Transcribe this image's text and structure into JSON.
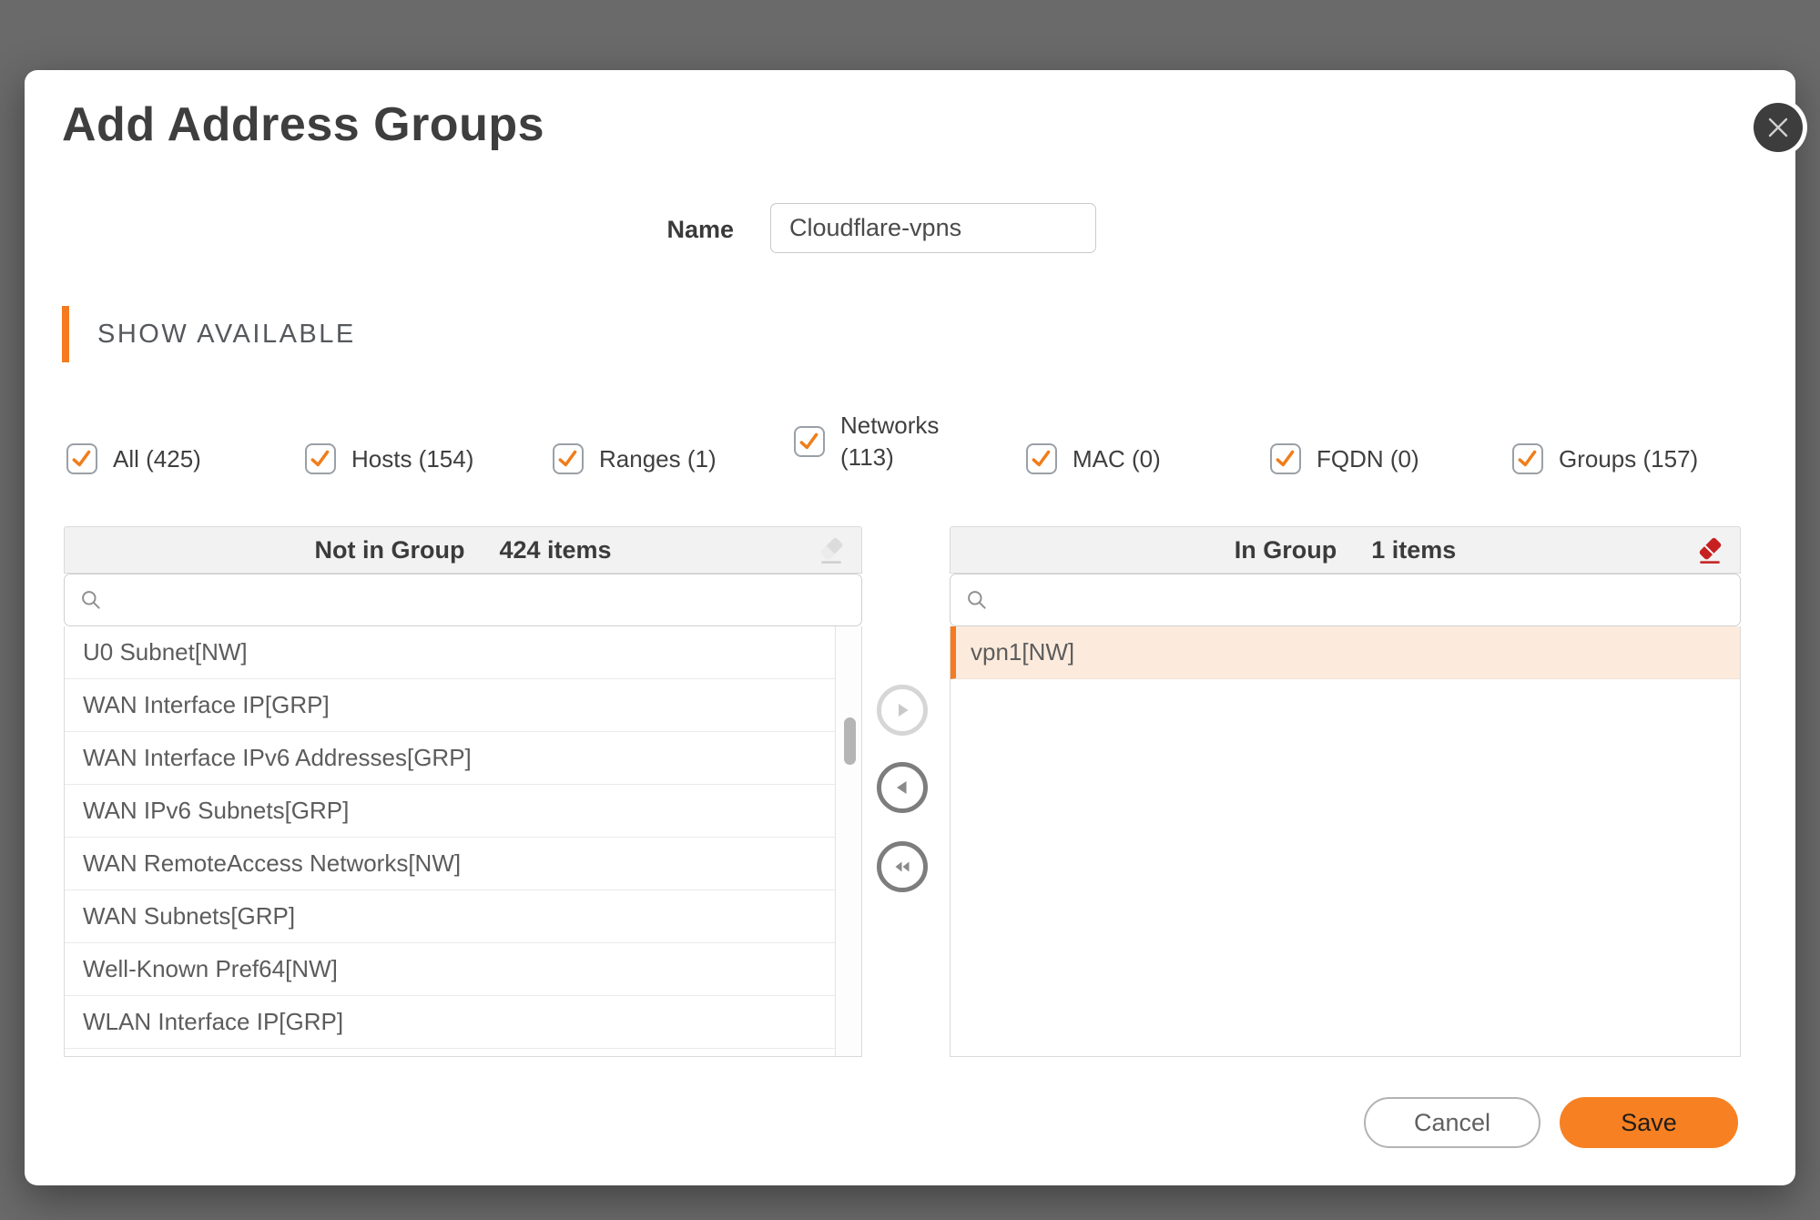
{
  "modal": {
    "title": "Add Address Groups"
  },
  "name_field": {
    "label": "Name",
    "value": "Cloudflare-vpns"
  },
  "section_header": {
    "label": "SHOW AVAILABLE"
  },
  "filters": {
    "items": [
      {
        "label": "All (425)",
        "checked": true
      },
      {
        "label": "Hosts (154)",
        "checked": true
      },
      {
        "label": "Ranges (1)",
        "checked": true
      },
      {
        "label": "Networks (113)",
        "checked": true
      },
      {
        "label": "MAC (0)",
        "checked": true
      },
      {
        "label": "FQDN (0)",
        "checked": true
      },
      {
        "label": "Groups (157)",
        "checked": true
      }
    ]
  },
  "left_panel": {
    "title": "Not in Group",
    "count": "424 items",
    "search_value": "",
    "items": [
      "U0 Subnet[NW]",
      "WAN Interface IP[GRP]",
      "WAN Interface IPv6 Addresses[GRP]",
      "WAN IPv6 Subnets[GRP]",
      "WAN RemoteAccess Networks[NW]",
      "WAN Subnets[GRP]",
      "Well-Known Pref64[NW]",
      "WLAN Interface IP[GRP]"
    ]
  },
  "right_panel": {
    "title": "In Group",
    "count": "1 items",
    "search_value": "",
    "items": [
      "vpn1[NW]"
    ]
  },
  "footer": {
    "cancel_label": "Cancel",
    "save_label": "Save"
  },
  "colors": {
    "accent": "#F47B20",
    "save_button": "#F78122",
    "eraser_red": "#C62020",
    "selected_row_bg": "#FCEBDD"
  }
}
